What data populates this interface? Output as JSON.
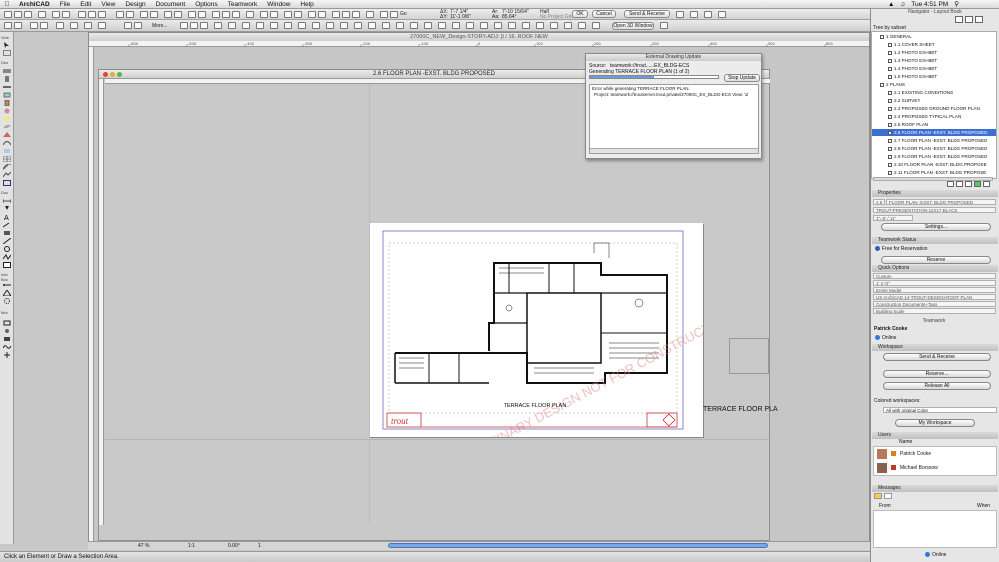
{
  "menubar": {
    "app": "ArchiCAD",
    "items": [
      "File",
      "Edit",
      "View",
      "Design",
      "Document",
      "Options",
      "Teamwork",
      "Window",
      "Help"
    ],
    "clock": "Tue 4:51 PM"
  },
  "toolbar": {
    "ok": "OK",
    "cancel": "Cancel",
    "go": "Go",
    "more": "More...",
    "send_receive": "Send & Receive",
    "open3d": "Open 3D Window",
    "dx_label": "ΔX:",
    "dx": "7'-7 1/4\"",
    "dy_label": "ΔY:",
    "dy": "11'-1 0/8\"",
    "r_label": "Ar:",
    "r": "7'-10 15/64\"",
    "a_label": "Aa:",
    "a": "85.64°",
    "half": "Half",
    "no_project_grid": "No Project Grid"
  },
  "toolbox": {
    "groups": [
      "Sele",
      "Des",
      "Doc",
      "Info Box",
      "Mor"
    ]
  },
  "main_window": {
    "title": "27000C_NEW_Design-STORY-ADJ: [I / 16. ROOF NEW",
    "ruler_ticks": [
      "-600",
      "-500",
      "-400",
      "-300",
      "-200",
      "-100",
      "0",
      "100",
      "200",
      "300",
      "400",
      "500",
      "600"
    ]
  },
  "layout_window": {
    "title": "2.6 FLOOR PLAN -EXST. BLDG PROPOSED"
  },
  "sheet": {
    "plan_title": "TERRACE FLOOR PLAN",
    "watermark": "PRELIMINARY DESIGN NOT FOR CONSTRUCTION",
    "logo": "trout"
  },
  "outside_label": "TERRACE FLOOR PLA",
  "dialog": {
    "title": "External Drawing Update",
    "source_label": "Source:",
    "source": "teamwork://trout......EX_BLDG-ECS",
    "generating": "Generating TERRACE FLOOR PLAN (1 of 2)",
    "stop": "Stop Update",
    "log_line1": "Error while generating TERRACE FLOOR PLAN.",
    "log_line2": "Project: teamwork://troutserver.trout.private/27000C_EX_BLDG-ECS View: \\2"
  },
  "status": {
    "hint": "Click an Element or Draw a Selection Area.",
    "zoom": "47 %",
    "scale": "1:1",
    "angle": "0.00°",
    "page": "1"
  },
  "navigator": {
    "title": "Navigator - Layout Book",
    "subset": "Tree by subset",
    "rows": [
      {
        "indent": 1,
        "label": "1 GENERAL"
      },
      {
        "indent": 2,
        "label": "1.1 COVER SHEET"
      },
      {
        "indent": 2,
        "label": "1.2 PHOTO EXHIBIT"
      },
      {
        "indent": 2,
        "label": "1.3 PHOTO EXHIBIT"
      },
      {
        "indent": 2,
        "label": "1.4 PHOTO EXHIBIT"
      },
      {
        "indent": 2,
        "label": "1.5 PHOTO EXHIBIT"
      },
      {
        "indent": 1,
        "label": "2 PLANS"
      },
      {
        "indent": 2,
        "label": "2.1 EXISTING CONDITIONS"
      },
      {
        "indent": 2,
        "label": "2.2 SURVEY"
      },
      {
        "indent": 2,
        "label": "2.3 PROPOSED GROUND FLOOR PLAN"
      },
      {
        "indent": 2,
        "label": "2.4 PROPOSED TYPICAL PLAN"
      },
      {
        "indent": 2,
        "label": "2.5 ROOF PLAN"
      },
      {
        "indent": 2,
        "label": "2.6 FLOOR PLAN -EXST. BLDG PROPOSED"
      },
      {
        "indent": 2,
        "label": "2.7 FLOOR PLAN -EXST. BLDG PROPOSED"
      },
      {
        "indent": 2,
        "label": "2.8 FLOOR PLAN -EXST. BLDG PROPOSED"
      },
      {
        "indent": 2,
        "label": "2.9 FLOOR PLAN -EXST. BLDG PROPOSED"
      },
      {
        "indent": 2,
        "label": "2.10 FLOOR PLAN -EXST. BLDG PROPOSE"
      },
      {
        "indent": 2,
        "label": "2.11 FLOOR PLAN -EXST. BLDG PROPOSE"
      }
    ]
  },
  "properties": {
    "title": "Properties",
    "id": "2.6",
    "name": "FLOOR PLAN -EXST. BLDG PROPOSED",
    "master": "TROUT-PRESENTATION-11X17-BLACK",
    "scale": "1\"=5' / 11\"",
    "settings": "Settings..."
  },
  "teamwork_status": {
    "title": "Teamwork Status",
    "status": "Free for Reservation",
    "reserve": "Reserve"
  },
  "quick_options": {
    "title": "Quick Options",
    "rows": [
      "Custom",
      "1'    1'-0\"",
      "Entire Model",
      "US ArchiCAD 14-TROUT-DESIGN-ROOF PLAN",
      "Construction Documents+Tags",
      "Building Scale"
    ]
  },
  "teamwork": {
    "title": "Teamwork",
    "user": "Patrick Cooke",
    "online": "Online",
    "workspace": "Workspace",
    "send_receive": "Send & Receive",
    "reserve": "Reserve...",
    "release_all": "Release All",
    "colored_workspaces": "Colored workspaces:",
    "color_option": "All with original Color",
    "my_workspace": "My Workspace",
    "users_title": "Users",
    "name_col": "Name",
    "users": [
      "Patrick Cooke",
      "Michael Borssow"
    ],
    "messages_title": "Messages",
    "from_col": "From",
    "when_col": "When",
    "footer": "Online"
  },
  "colors": {
    "selection": "#3b6fd4",
    "watermark": "#e38a8a",
    "user1": "#e07b20",
    "user2": "#c0392b"
  }
}
